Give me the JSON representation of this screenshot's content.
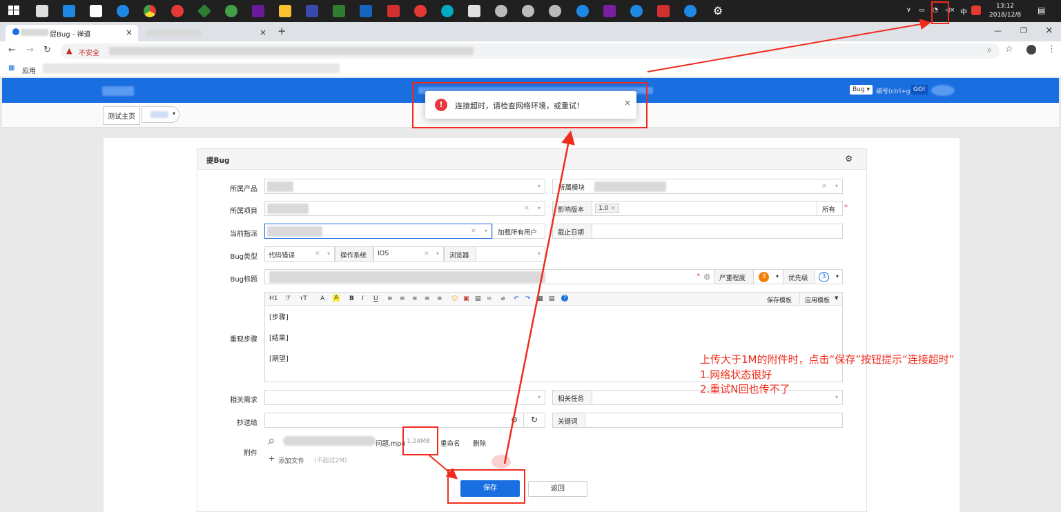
{
  "tray": {
    "ime": "中",
    "time": "13:12",
    "date": "2018/12/8"
  },
  "browser": {
    "tab1_title": "提Bug - 禅道",
    "tab_close": "×",
    "new_tab": "+",
    "insecure": "不安全",
    "bookmark_apps": "应用"
  },
  "app": {
    "breadcrumb_home": "测试主页",
    "search_type": "Bug",
    "search_placeholder": "编号(ctrl+g",
    "go": "GO!"
  },
  "toast": {
    "message": "连接超时，请检查网络环境，或重试！",
    "close": "×"
  },
  "form": {
    "title": "提Bug",
    "labels": {
      "product": "所属产品",
      "module": "所属模块",
      "project": "所属项目",
      "affected_version": "影响版本",
      "all": "所有",
      "assigned": "当前指派",
      "load_all_users": "加载所有用户",
      "deadline": "截止日期",
      "bug_type": "Bug类型",
      "os": "操作系统",
      "browser": "浏览器",
      "bug_title": "Bug标题",
      "severity": "严重程度",
      "priority": "优先级",
      "steps": "重现步骤",
      "related_story": "相关需求",
      "related_task": "相关任务",
      "cc": "抄送给",
      "keywords": "关键词",
      "attachment": "附件"
    },
    "values": {
      "affected_version": "1.0",
      "bug_type": "代码错误",
      "os": "IOS",
      "severity_num": "3",
      "priority_num": "3"
    },
    "editor": {
      "toolbar": [
        "H1",
        "ℱ",
        "ᴛT",
        "A",
        "A",
        "B",
        "I",
        "U",
        "≡",
        "≡",
        "≡",
        "≡",
        "≡",
        "☺",
        "▣",
        "▤",
        "∞",
        "⌀",
        "↶",
        "↷",
        "▦",
        "▤",
        "?"
      ],
      "save_template": "保存模板",
      "apply_template": "应用模板",
      "lines": [
        "[步骤]",
        "[结果]",
        "[期望]"
      ]
    },
    "attachment": {
      "file_suffix": "问题.mp4",
      "size": "1.24MB",
      "rename": "重命名",
      "delete": "删除",
      "add_file": "添加文件",
      "limit": "(不超过2M)"
    },
    "save_button": "保存",
    "back_button": "返回"
  },
  "annotation": {
    "line1": "上传大于1M的附件时，点击“保存”按钮提示“连接超时”",
    "line2": "1.网络状态很好",
    "line3": "2.重试N回也传不了"
  },
  "colors": {
    "accent": "#1a6fe0",
    "annotation_red": "#f02b1d",
    "error_red": "#e8383d"
  }
}
